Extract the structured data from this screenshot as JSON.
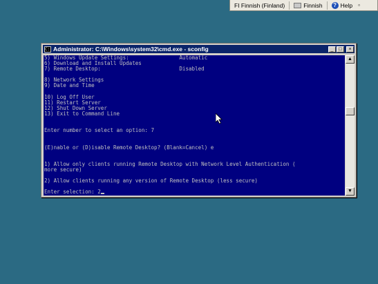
{
  "language_bar": {
    "language": "FI Finnish (Finland)",
    "keyboard": "Finnish",
    "help": "Help"
  },
  "window": {
    "title": "Administrator: C:\\Windows\\system32\\cmd.exe - sconfig",
    "minimize": "_",
    "maximize": "□",
    "close": "×"
  },
  "console_lines": [
    "5) Windows Update Settings:                Automatic",
    "6) Download and Install Updates",
    "7) Remote Desktop:                         Disabled",
    "",
    "8) Network Settings",
    "9) Date and Time",
    "",
    "10) Log Off User",
    "11) Restart Server",
    "12) Shut Down Server",
    "13) Exit to Command Line",
    "",
    "",
    "Enter number to select an option: 7",
    "",
    "",
    "(E)nable or (D)isable Remote Desktop? (Blank=Cancel) e",
    "",
    "",
    "1) Allow only clients running Remote Desktop with Network Level Authentication (",
    "more secure)",
    "",
    "2) Allow clients running any version of Remote Desktop (less secure)",
    "",
    "Enter selection: 2"
  ]
}
